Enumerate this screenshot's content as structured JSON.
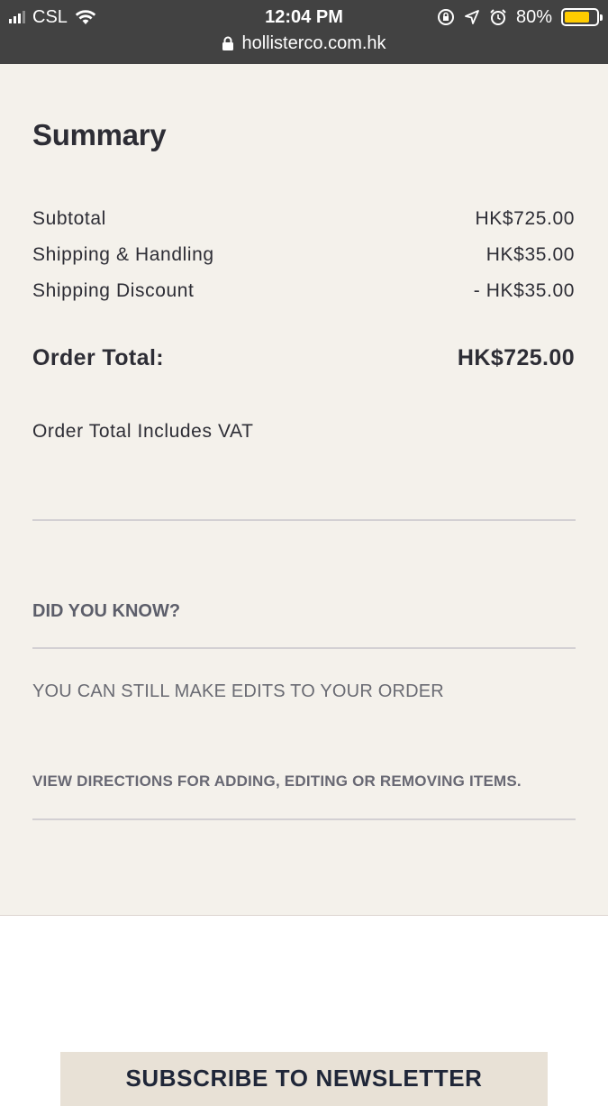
{
  "status_bar": {
    "carrier": "CSL",
    "time": "12:04 PM",
    "battery_percent": "80%",
    "battery_level": 0.8,
    "icons": [
      "signal-icon",
      "wifi-icon",
      "orientation-lock-icon",
      "location-icon",
      "alarm-icon",
      "battery-icon"
    ]
  },
  "browser": {
    "url": "hollisterco.com.hk"
  },
  "summary": {
    "title": "Summary",
    "subtotal_label": "Subtotal",
    "subtotal_value": "HK$725.00",
    "shipping_label": "Shipping & Handling",
    "shipping_value": "HK$35.00",
    "discount_label": "Shipping Discount",
    "discount_value": "- HK$35.00",
    "total_label": "Order Total:",
    "total_value": "HK$725.00",
    "vat_note": "Order Total Includes VAT"
  },
  "info": {
    "did_you_know": "DID YOU KNOW?",
    "edits_note": "YOU CAN STILL MAKE EDITS TO YOUR ORDER",
    "directions_link": "VIEW DIRECTIONS FOR ADDING, EDITING OR REMOVING ITEMS."
  },
  "footer": {
    "newsletter_label": "SUBSCRIBE TO NEWSLETTER"
  },
  "colors": {
    "panel_bg": "#f4f1eb",
    "topbar_bg": "#424242",
    "battery_fill": "#ffcc00",
    "newsletter_bg": "#e8e1d6"
  }
}
